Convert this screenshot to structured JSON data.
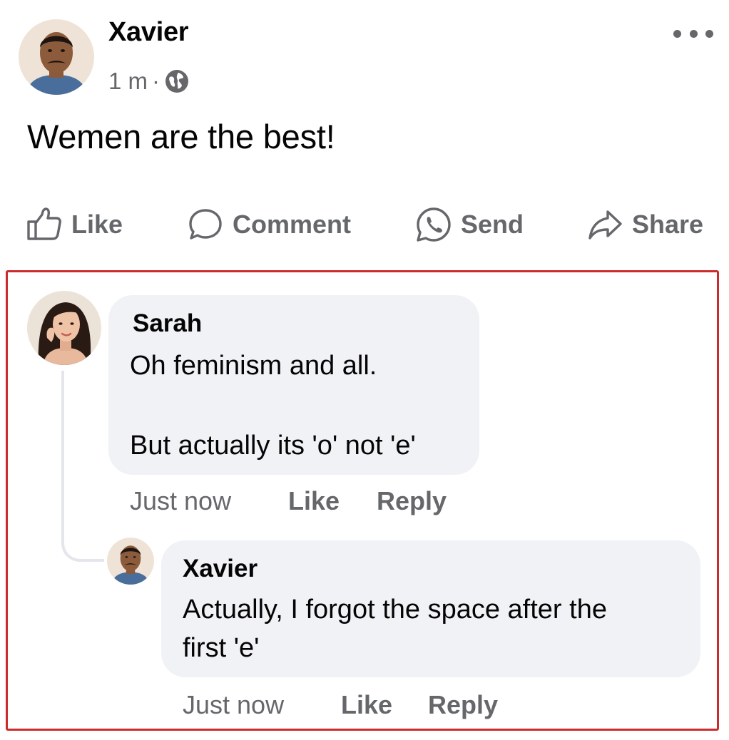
{
  "post": {
    "author": "Xavier",
    "time": "1 m",
    "separator": "·",
    "privacy_icon": "globe-icon",
    "more_icon": "more-options-icon",
    "text": "Wemen are the best!"
  },
  "actions": {
    "like": "Like",
    "comment": "Comment",
    "send": "Send",
    "share": "Share"
  },
  "comments": [
    {
      "author": "Sarah",
      "lines": [
        "Oh feminism and all.",
        "But actually its 'o' not 'e'"
      ],
      "time": "Just now",
      "like": "Like",
      "reply": "Reply",
      "replies": [
        {
          "author": "Xavier",
          "lines": [
            "Actually, I forgot the space after the",
            "first 'e'"
          ],
          "time": "Just now",
          "like": "Like",
          "reply": "Reply"
        }
      ]
    }
  ],
  "colors": {
    "text": "#050505",
    "secondary_text": "#65676b",
    "bubble": "#f0f2f5",
    "highlight_border": "#cc2b2b"
  }
}
